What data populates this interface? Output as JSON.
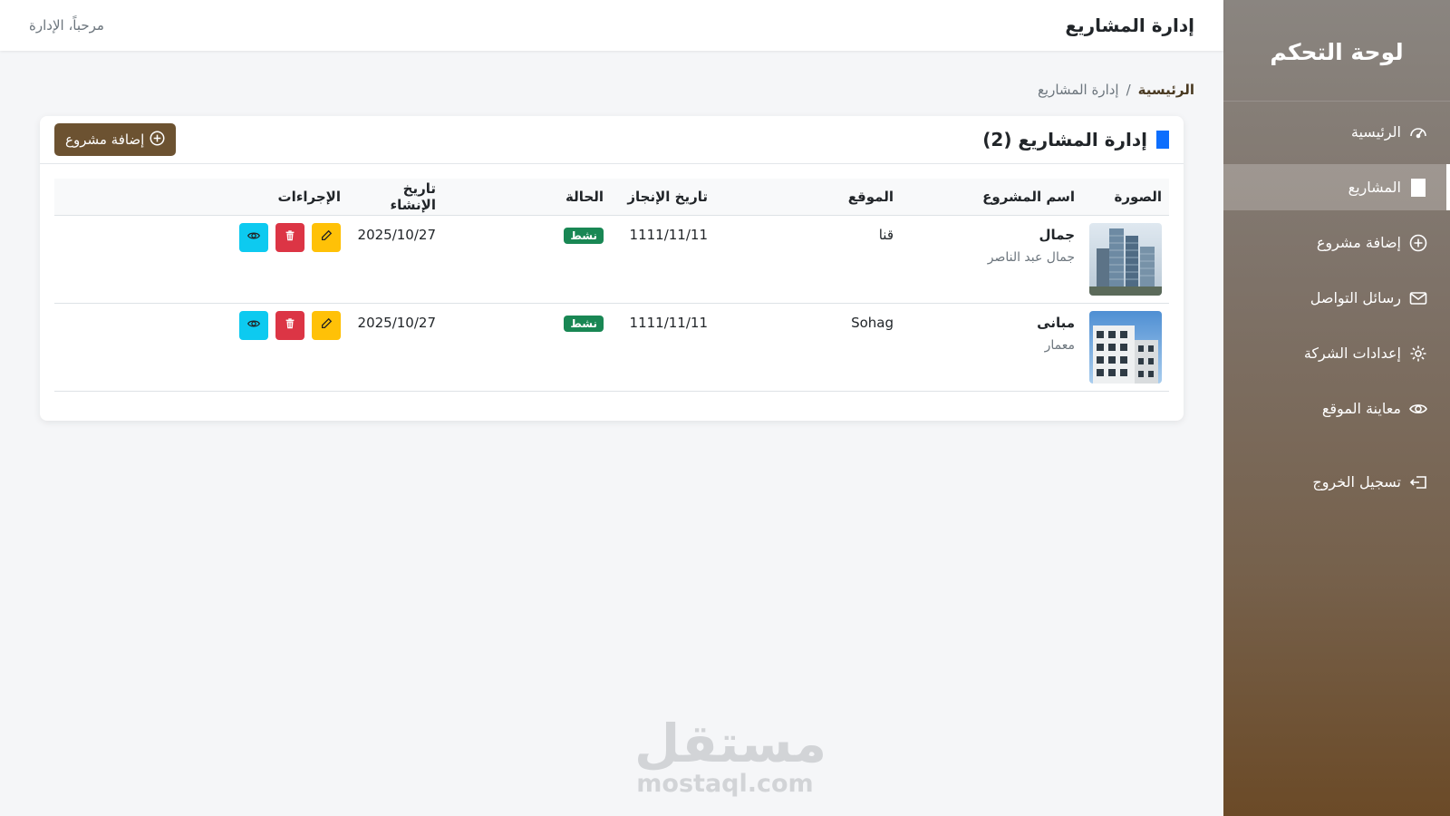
{
  "sidebar": {
    "title": "لوحة التحكم",
    "items": [
      {
        "label": "الرئيسية",
        "icon": "dashboard-icon"
      },
      {
        "label": "المشاريع",
        "icon": "project-icon",
        "active": true
      },
      {
        "label": "إضافة مشروع",
        "icon": "plus-circle-icon"
      },
      {
        "label": "رسائل التواصل",
        "icon": "envelope-icon"
      },
      {
        "label": "إعدادات الشركة",
        "icon": "gear-icon"
      },
      {
        "label": "معاينة الموقع",
        "icon": "eye-icon"
      }
    ],
    "logout": {
      "label": "تسجيل الخروج",
      "icon": "logout-icon"
    }
  },
  "topbar": {
    "title": "إدارة المشاريع",
    "welcome": "مرحباً، الإدارة"
  },
  "breadcrumb": {
    "home": "الرئيسية",
    "separator": "/",
    "current": "إدارة المشاريع"
  },
  "card": {
    "title": "إدارة المشاريع (2)",
    "add_button": "إضافة مشروع"
  },
  "table": {
    "headers": [
      "الصورة",
      "اسم المشروع",
      "الموقع",
      "تاريخ الإنجاز",
      "الحالة",
      "تاريخ الإنشاء",
      "الإجراءات"
    ],
    "rows": [
      {
        "name": "جمال",
        "subtitle": "جمال عبد الناصر",
        "location": "قنا",
        "completion_date": "1111/11/11",
        "status": "نشط",
        "created": "2025/10/27"
      },
      {
        "name": "مبانى",
        "subtitle": "معمار",
        "location": "Sohag",
        "completion_date": "1111/11/11",
        "status": "نشط",
        "created": "2025/10/27"
      }
    ]
  },
  "watermark": {
    "arabic": "مستقل",
    "latin": "mostaql.com"
  },
  "colors": {
    "accent": "#6c5231",
    "badge": "#198754",
    "edit": "#ffc107",
    "delete": "#dc3545",
    "view": "#0dcaf0",
    "title_square": "#0d6efd"
  }
}
